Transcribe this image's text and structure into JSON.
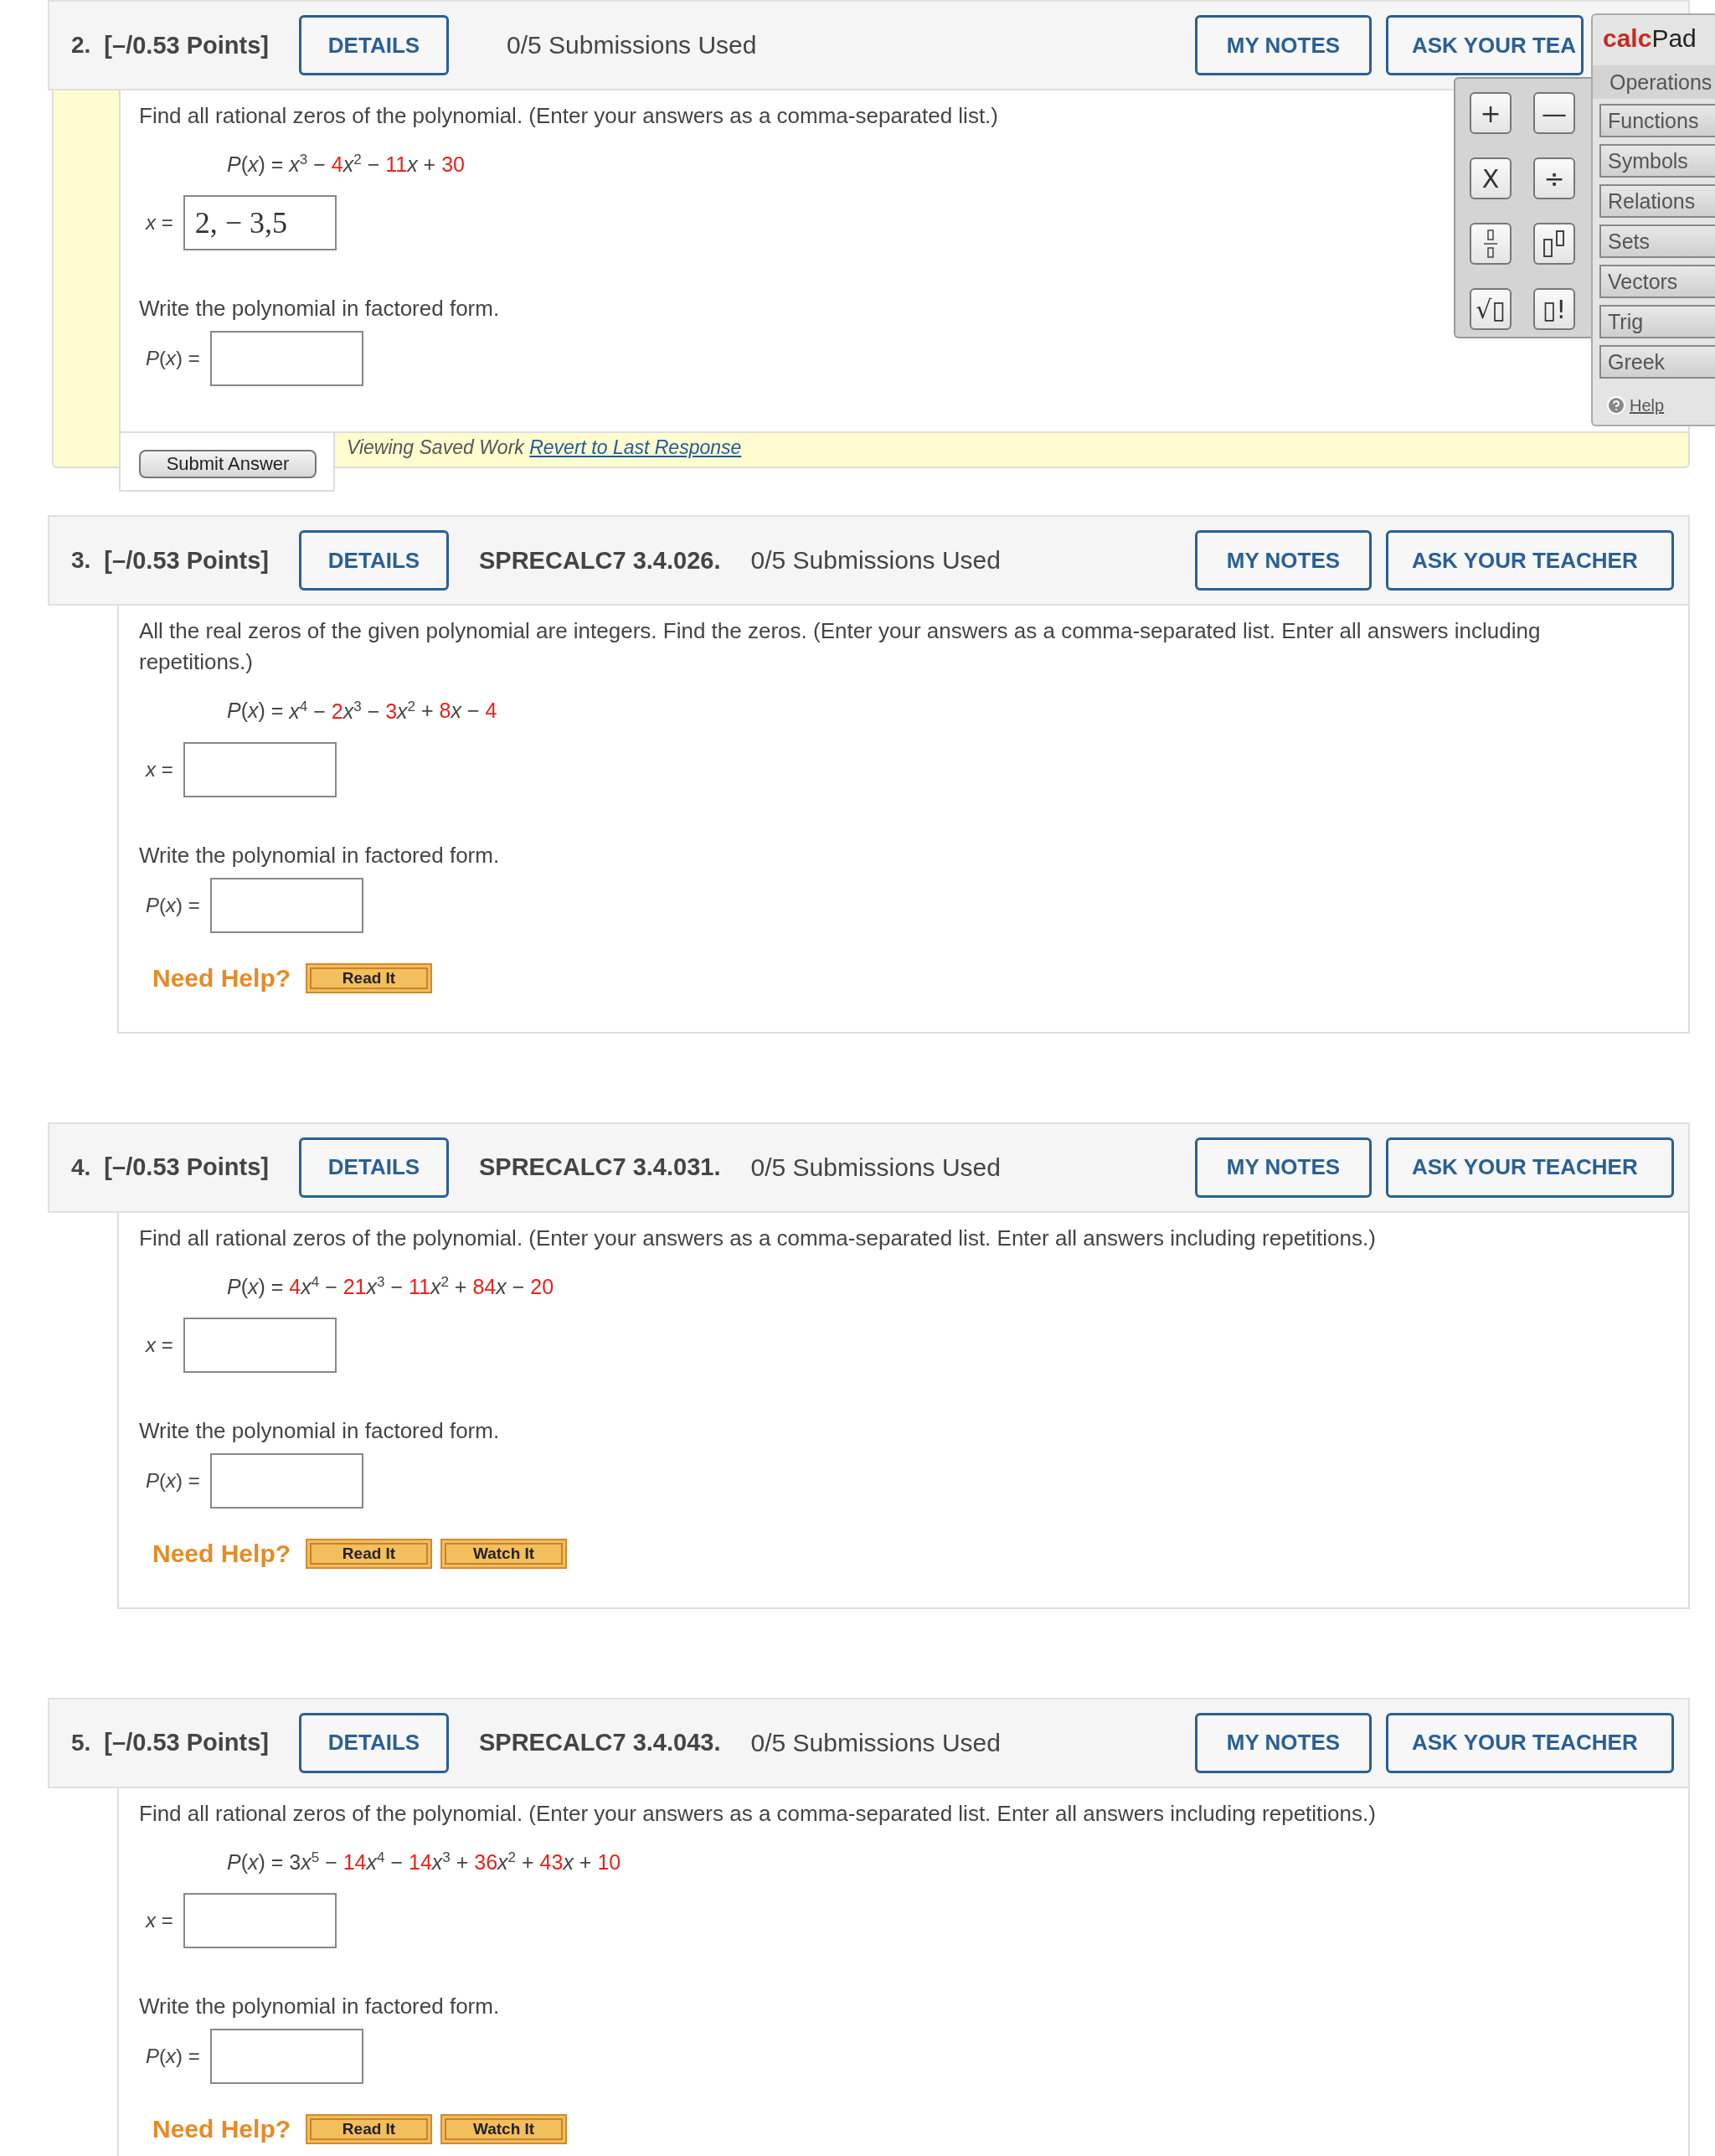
{
  "questions": [
    {
      "number": "2.",
      "points": "[–/0.53 Points]",
      "details": "DETAILS",
      "submissions": "0/5 Submissions Used",
      "notes": "MY NOTES",
      "ask": "ASK YOUR TEA",
      "prompt": "Find all rational zeros of the polynomial. (Enter your answers as a comma-separated list.)",
      "equation": {
        "lhs": "*P*(*x*) =",
        "terms": [
          {
            "variable": "x",
            "exponent": "3"
          },
          {
            "op": "−",
            "coef": "4",
            "highlighted": true,
            "variable": "x",
            "exponent": "2"
          },
          {
            "op": "−",
            "coef": "11",
            "highlighted": true,
            "variable": "x"
          },
          {
            "op": "+",
            "coef": "30",
            "highlighted": true
          }
        ]
      },
      "zeros_field": {
        "label": "*x* =",
        "value": "2, − 3,5"
      },
      "factored_prompt": "Write the polynomial in factored form.",
      "factored_field": {
        "label": "*P*(*x*) ="
      },
      "saved_work": {
        "text": "Viewing Saved Work",
        "link": "Revert to Last Response"
      },
      "submit": "Submit Answer"
    },
    {
      "number": "3.",
      "points": "[–/0.53 Points]",
      "details": "DETAILS",
      "code": "SPRECALC7 3.4.026.",
      "submissions": "0/5 Submissions Used",
      "notes": "MY NOTES",
      "ask": "ASK YOUR TEACHER",
      "prompt": "All the real zeros of the given polynomial are integers. Find the zeros. (Enter your answers as a comma-separated list. Enter all answers including repetitions.)",
      "equation": {
        "lhs": "*P*(*x*) =",
        "terms": [
          {
            "variable": "x",
            "exponent": "4"
          },
          {
            "op": "−",
            "coef": "2",
            "highlighted": true,
            "variable": "x",
            "exponent": "3"
          },
          {
            "op": "−",
            "coef": "3",
            "highlighted": true,
            "variable": "x",
            "exponent": "2"
          },
          {
            "op": "+",
            "coef": "8",
            "highlighted": true,
            "variable": "x"
          },
          {
            "op": "−",
            "coef": "4",
            "highlighted": true
          }
        ]
      },
      "zeros_field": {
        "label": "*x* ="
      },
      "factored_prompt": "Write the polynomial in factored form.",
      "factored_field": {
        "label": "*P*(*x*) ="
      },
      "help_label": "Need Help?",
      "help_buttons": [
        "Read It"
      ]
    },
    {
      "number": "4.",
      "points": "[–/0.53 Points]",
      "details": "DETAILS",
      "code": "SPRECALC7 3.4.031.",
      "submissions": "0/5 Submissions Used",
      "notes": "MY NOTES",
      "ask": "ASK YOUR TEACHER",
      "prompt": "Find all rational zeros of the polynomial. (Enter your answers as a comma-separated list. Enter all answers including repetitions.)",
      "equation": {
        "lhs": "*P*(*x*) =",
        "terms": [
          {
            "coef": "4",
            "highlighted": true,
            "variable": "x",
            "exponent": "4"
          },
          {
            "op": "−",
            "coef": "21",
            "highlighted": true,
            "variable": "x",
            "exponent": "3"
          },
          {
            "op": "−",
            "coef": "11",
            "highlighted": true,
            "variable": "x",
            "exponent": "2"
          },
          {
            "op": "+",
            "coef": "84",
            "highlighted": true,
            "variable": "x"
          },
          {
            "op": "−",
            "coef": "20",
            "highlighted": true
          }
        ]
      },
      "zeros_field": {
        "label": "*x* ="
      },
      "factored_prompt": "Write the polynomial in factored form.",
      "factored_field": {
        "label": "*P*(*x*) ="
      },
      "help_label": "Need Help?",
      "help_buttons": [
        "Read It",
        "Watch It"
      ]
    },
    {
      "number": "5.",
      "points": "[–/0.53 Points]",
      "details": "DETAILS",
      "code": "SPRECALC7 3.4.043.",
      "submissions": "0/5 Submissions Used",
      "notes": "MY NOTES",
      "ask": "ASK YOUR TEACHER",
      "prompt": "Find all rational zeros of the polynomial. (Enter your answers as a comma-separated list. Enter all answers including repetitions.)",
      "equation": {
        "lhs": "*P*(*x*) =",
        "terms": [
          {
            "coef": "3",
            "highlighted": false,
            "variable": "x",
            "exponent": "5"
          },
          {
            "op": "−",
            "coef": "14",
            "highlighted": true,
            "variable": "x",
            "exponent": "4"
          },
          {
            "op": "−",
            "coef": "14",
            "highlighted": true,
            "variable": "x",
            "exponent": "3"
          },
          {
            "op": "+",
            "coef": "36",
            "highlighted": true,
            "variable": "x",
            "exponent": "2"
          },
          {
            "op": "+",
            "coef": "43",
            "highlighted": true,
            "variable": "x"
          },
          {
            "op": "+",
            "coef": "10",
            "highlighted": true
          }
        ]
      },
      "zeros_field": {
        "label": "*x* ="
      },
      "factored_prompt": "Write the polynomial in factored form.",
      "factored_field": {
        "label": "*P*(*x*) ="
      },
      "help_label": "Need Help?",
      "help_buttons": [
        "Read It",
        "Watch It"
      ]
    }
  ],
  "calcpad": {
    "title_bold": "calc",
    "title_rest": "Pad",
    "tabs": [
      {
        "label": "Operations",
        "selected": true
      },
      {
        "label": "Functions",
        "selected": false
      },
      {
        "label": "Symbols",
        "selected": false
      },
      {
        "label": "Relations",
        "selected": false
      },
      {
        "label": "Sets",
        "selected": false
      },
      {
        "label": "Vectors",
        "selected": false
      },
      {
        "label": "Trig",
        "selected": false
      },
      {
        "label": "Greek",
        "selected": false
      }
    ],
    "keys": [
      {
        "kind": "text",
        "label": "+"
      },
      {
        "kind": "text",
        "label": "—"
      },
      {
        "kind": "text",
        "label": "X"
      },
      {
        "kind": "text",
        "label": "÷"
      },
      {
        "kind": "fraction"
      },
      {
        "kind": "power"
      },
      {
        "kind": "text",
        "label": "√▯"
      },
      {
        "kind": "text",
        "label": "▯!"
      }
    ],
    "help": "Help"
  }
}
